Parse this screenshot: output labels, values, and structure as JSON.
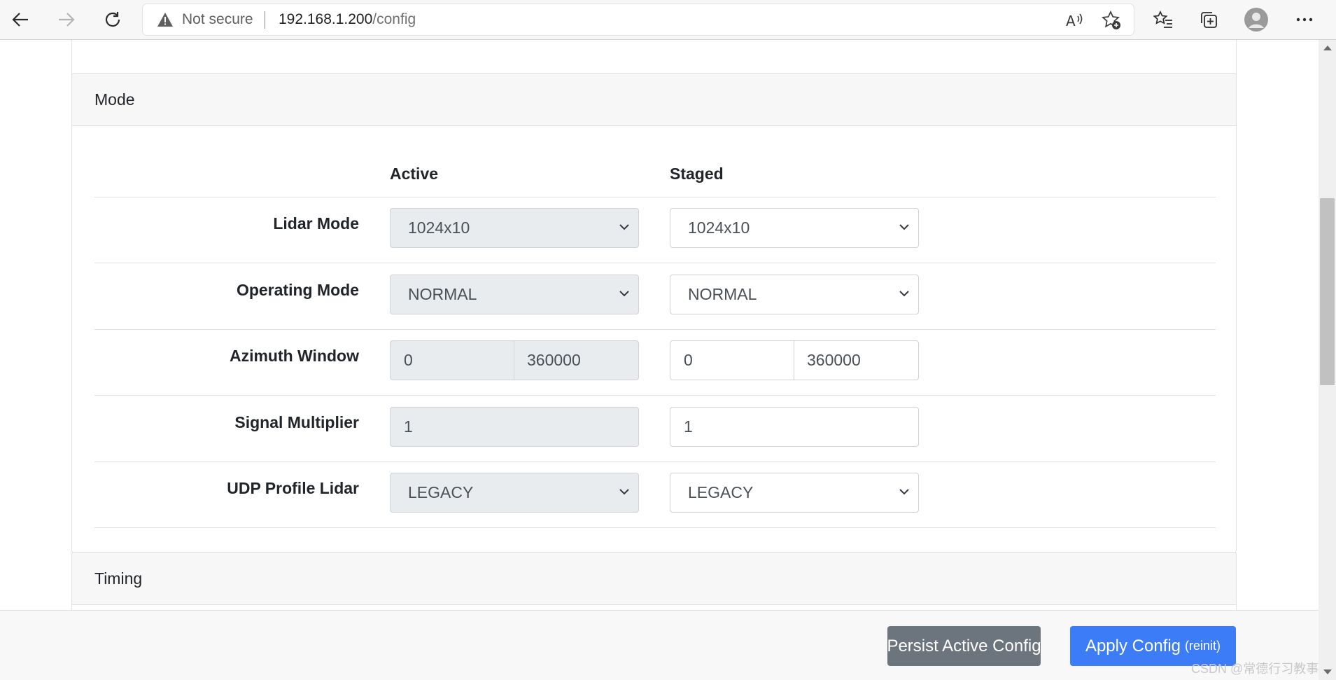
{
  "browser": {
    "security_label": "Not secure",
    "url_host": "192.168.1.200",
    "url_path": "/config"
  },
  "mode_section": {
    "title": "Mode",
    "columns": {
      "active": "Active",
      "staged": "Staged"
    },
    "rows": [
      {
        "label": "Lidar Mode",
        "active": "1024x10",
        "staged": "1024x10"
      },
      {
        "label": "Operating Mode",
        "active": "NORMAL",
        "staged": "NORMAL"
      },
      {
        "label": "Azimuth Window",
        "active_start": "0",
        "active_end": "360000",
        "staged_start": "0",
        "staged_end": "360000"
      },
      {
        "label": "Signal Multiplier",
        "active": "1",
        "staged": "1"
      },
      {
        "label": "UDP Profile Lidar",
        "active": "LEGACY",
        "staged": "LEGACY"
      }
    ]
  },
  "timing_section": {
    "title": "Timing"
  },
  "footer": {
    "persist_label": "Persist Active Config",
    "apply_label": "Apply Config",
    "apply_sub_label": "(reinit)"
  },
  "watermark": "CSDN @常德行习教事"
}
